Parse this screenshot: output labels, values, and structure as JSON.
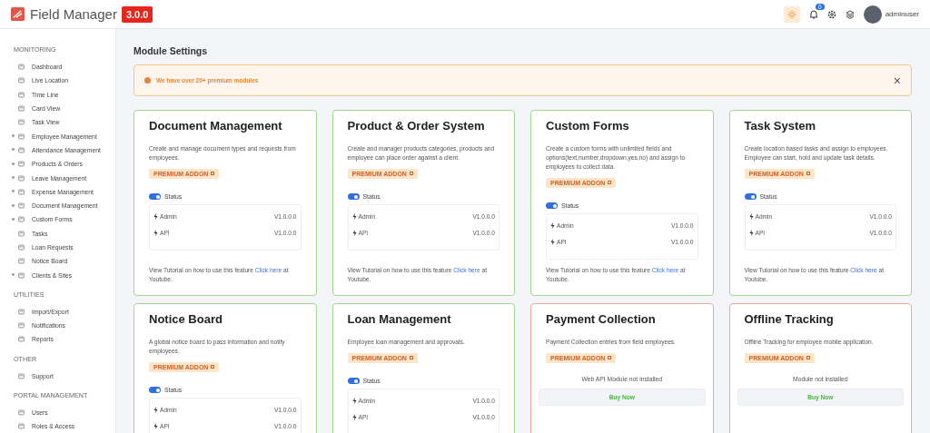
{
  "topbar": {
    "brand": "Field Manager",
    "version": "3.0.0",
    "notification_count": "0",
    "user": "adminuser"
  },
  "sidebar": {
    "sections": [
      {
        "title": "MONITORING",
        "items": [
          {
            "label": "Dashboard",
            "expandable": false
          },
          {
            "label": "Live Location",
            "expandable": false
          },
          {
            "label": "Time Line",
            "expandable": false
          },
          {
            "label": "Card View",
            "expandable": false
          },
          {
            "label": "Task View",
            "expandable": false
          },
          {
            "label": "Employee Management",
            "expandable": true
          },
          {
            "label": "Attendance Management",
            "expandable": true
          },
          {
            "label": "Products & Orders",
            "expandable": true
          },
          {
            "label": "Leave Management",
            "expandable": true
          },
          {
            "label": "Expense Management",
            "expandable": true
          },
          {
            "label": "Document Management",
            "expandable": true
          },
          {
            "label": "Custom Forms",
            "expandable": true
          },
          {
            "label": "Tasks",
            "expandable": false
          },
          {
            "label": "Loan Requests",
            "expandable": false
          },
          {
            "label": "Notice Board",
            "expandable": false
          },
          {
            "label": "Clients & Sites",
            "expandable": true
          }
        ]
      },
      {
        "title": "UTILITIES",
        "items": [
          {
            "label": "Import/Export",
            "expandable": false
          },
          {
            "label": "Notifications",
            "expandable": false
          },
          {
            "label": "Reports",
            "expandable": false
          }
        ]
      },
      {
        "title": "OTHER",
        "items": [
          {
            "label": "Support",
            "expandable": false
          }
        ]
      },
      {
        "title": "PORTAL MANAGEMENT",
        "items": [
          {
            "label": "Users",
            "expandable": false
          },
          {
            "label": "Roles & Access",
            "expandable": false
          }
        ]
      }
    ]
  },
  "page_title": "Module Settings",
  "alert": {
    "text": "We have over 20+ premium modules",
    "close": "×"
  },
  "modules": [
    {
      "kind": "installed",
      "title": "Document Management",
      "description": "Create and manage document types and requests from employees.",
      "badge": "PREMIUM ADDON",
      "status_label": "Status",
      "status_on": true,
      "versions": [
        {
          "name": "Admin",
          "version": "V1.0.0.0"
        },
        {
          "name": "API",
          "version": "V1.0.0.0"
        }
      ],
      "tutorial": "View Tutorial on how to use this feature",
      "link": "Click here",
      "tutorial_end": "at Youtube."
    },
    {
      "kind": "installed",
      "title": "Product & Order System",
      "description": "Create and manager products categories, products and employee can place order against a client.",
      "badge": "PREMIUM ADDON",
      "status_label": "Status",
      "status_on": true,
      "versions": [
        {
          "name": "Admin",
          "version": "V1.0.0.0"
        },
        {
          "name": "API",
          "version": "V1.0.0.0"
        }
      ],
      "tutorial": "View Tutorial on how to use this feature",
      "link": "Click here",
      "tutorial_end": "at Youtube."
    },
    {
      "kind": "installed",
      "title": "Custom Forms",
      "description": "Create a custom forms with unlimited fields and options(text,number,dropdown,yes,no) and assign to employees to collect data.",
      "badge": "PREMIUM ADDON",
      "status_label": "Status",
      "status_on": true,
      "versions": [
        {
          "name": "Admin",
          "version": "V1.0.0.0"
        },
        {
          "name": "API",
          "version": "V1.0.0.0"
        }
      ],
      "tutorial": "View Tutorial on how to use this feature",
      "link": "Click here",
      "tutorial_end": "at Youtube."
    },
    {
      "kind": "installed",
      "title": "Task System",
      "description": "Create location based tasks and assign to employees. Employee can start, hold and update task details.",
      "badge": "PREMIUM ADDON",
      "status_label": "Status",
      "status_on": true,
      "versions": [
        {
          "name": "Admin",
          "version": "V1.0.0.0"
        },
        {
          "name": "API",
          "version": "V1.0.0.0"
        }
      ],
      "tutorial": "View Tutorial on how to use this feature",
      "link": "Click here",
      "tutorial_end": "at Youtube."
    },
    {
      "kind": "installed",
      "title": "Notice Board",
      "description": "A global notice board to pass information and notify employees.",
      "badge": "PREMIUM ADDON",
      "status_label": "Status",
      "status_on": true,
      "versions": [
        {
          "name": "Admin",
          "version": "V1.0.0.0"
        },
        {
          "name": "API",
          "version": "V1.0.0.0"
        }
      ]
    },
    {
      "kind": "installed",
      "title": "Loan Management",
      "description": "Employee loan management and approvals.",
      "badge": "PREMIUM ADDON",
      "status_label": "Status",
      "status_on": true,
      "versions": [
        {
          "name": "Admin",
          "version": "V1.0.0.0"
        },
        {
          "name": "API",
          "version": "V1.0.0.0"
        }
      ]
    },
    {
      "kind": "not_installed",
      "title": "Payment Collection",
      "description": "Payment Collection entries from field employees.",
      "badge": "PREMIUM ADDON",
      "message": "Web API Module not installed",
      "button": "Buy Now"
    },
    {
      "kind": "not_installed",
      "title": "Offline Tracking",
      "description": "Offline Tracking for employee mobile application.",
      "badge": "PREMIUM ADDON",
      "message": "Module not installed",
      "button": "Buy Now"
    }
  ]
}
